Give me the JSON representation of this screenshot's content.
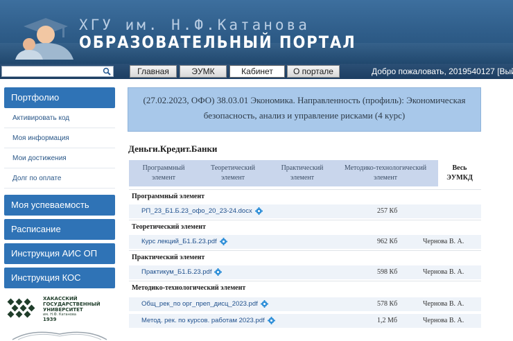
{
  "header": {
    "line1": "ХГУ им. Н.Ф.Катанова",
    "line2": "ОБРАЗОВАТЕЛЬНЫЙ ПОРТАЛ"
  },
  "search": {
    "value": ""
  },
  "nav": {
    "items": [
      {
        "label": "Главная",
        "active": false
      },
      {
        "label": "ЭУМК",
        "active": false
      },
      {
        "label": "Кабинет",
        "active": true
      },
      {
        "label": "О портале",
        "active": false
      }
    ],
    "welcome": "Добро пожаловать, 2019540127",
    "logout": "[Выйти]"
  },
  "sidebar": {
    "portfolio": "Портфолио",
    "items": [
      {
        "label": "Активировать код"
      },
      {
        "label": "Моя информация"
      },
      {
        "label": "Мои достижения"
      },
      {
        "label": "Долг по оплате"
      }
    ],
    "blocks": [
      {
        "label": "Моя успеваемость"
      },
      {
        "label": "Расписание"
      },
      {
        "label": "Инструкция АИС ОП"
      },
      {
        "label": "Инструкция КОС"
      }
    ],
    "university": {
      "line1": "ХАКАССКИЙ",
      "line2": "ГОСУДАРСТВЕННЫЙ",
      "line3": "УНИВЕРСИТЕТ",
      "line4": "им. Н.Ф. Катанова",
      "line5": "1939"
    }
  },
  "main": {
    "info": "(27.02.2023, ОФО) 38.03.01 Экономика. Направленность (профиль): Экономическая безопасность, анализ и управление рисками (4 курс)",
    "subject": "Деньги.Кредит.Банки",
    "tabs": [
      {
        "line1": "Программный",
        "line2": "элемент"
      },
      {
        "line1": "Теоретический",
        "line2": "элемент"
      },
      {
        "line1": "Практический",
        "line2": "элемент"
      },
      {
        "line1": "Методико-технологический",
        "line2": "элемент"
      },
      {
        "line1": "Весь",
        "line2": "ЭУМКД"
      }
    ],
    "sections": [
      {
        "title": "Программный элемент",
        "files": [
          {
            "name": "РП_23_Б1.Б.23_офо_20_23-24.docx",
            "size": "257 Кб",
            "author": ""
          }
        ]
      },
      {
        "title": "Теоретический элемент",
        "files": [
          {
            "name": "Курс лекций_Б1.Б.23.pdf",
            "size": "962 Кб",
            "author": "Чернова В. А."
          }
        ]
      },
      {
        "title": "Практический элемент",
        "files": [
          {
            "name": "Практикум_Б1.Б.23.pdf",
            "size": "598 Кб",
            "author": "Чернова В. А."
          }
        ]
      },
      {
        "title": "Методико-технологический элемент",
        "files": [
          {
            "name": "Общ_рек_по орг_преп_дисц_2023.pdf",
            "size": "578 Кб",
            "author": "Чернова В. А."
          },
          {
            "name": "Метод. рек. по курсов. работам 2023.pdf",
            "size": "1,2 Мб",
            "author": "Чернова В. А."
          }
        ]
      }
    ]
  },
  "colors": {
    "header": "#2e5c88",
    "sidebar_block": "#2f73b6",
    "info_box": "#a8c8ea",
    "tabs_bg": "#c9d6ec",
    "file_link": "#1e4f8c",
    "gear": "#2f8fd8"
  }
}
